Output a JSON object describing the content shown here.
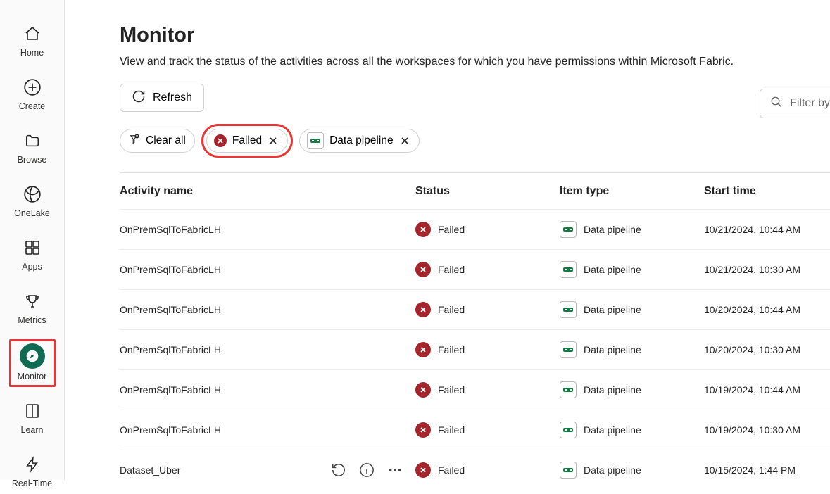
{
  "nav": {
    "items": [
      {
        "label": "Home"
      },
      {
        "label": "Create"
      },
      {
        "label": "Browse"
      },
      {
        "label": "OneLake"
      },
      {
        "label": "Apps"
      },
      {
        "label": "Metrics"
      },
      {
        "label": "Monitor"
      },
      {
        "label": "Learn"
      },
      {
        "label": "Real-Time"
      }
    ]
  },
  "header": {
    "title": "Monitor",
    "subtitle": "View and track the status of the activities across all the workspaces for which you have permissions within Microsoft Fabric."
  },
  "toolbar": {
    "refresh_label": "Refresh",
    "filter_placeholder": "Filter by"
  },
  "chips": {
    "clear_all": "Clear all",
    "failed": "Failed",
    "data_pipeline": "Data pipeline"
  },
  "table": {
    "columns": {
      "activity_name": "Activity name",
      "status": "Status",
      "item_type": "Item type",
      "start_time": "Start time"
    },
    "rows": [
      {
        "name": "OnPremSqlToFabricLH",
        "status": "Failed",
        "type": "Data pipeline",
        "start": "10/21/2024, 10:44 AM"
      },
      {
        "name": "OnPremSqlToFabricLH",
        "status": "Failed",
        "type": "Data pipeline",
        "start": "10/21/2024, 10:30 AM"
      },
      {
        "name": "OnPremSqlToFabricLH",
        "status": "Failed",
        "type": "Data pipeline",
        "start": "10/20/2024, 10:44 AM"
      },
      {
        "name": "OnPremSqlToFabricLH",
        "status": "Failed",
        "type": "Data pipeline",
        "start": "10/20/2024, 10:30 AM"
      },
      {
        "name": "OnPremSqlToFabricLH",
        "status": "Failed",
        "type": "Data pipeline",
        "start": "10/19/2024, 10:44 AM"
      },
      {
        "name": "OnPremSqlToFabricLH",
        "status": "Failed",
        "type": "Data pipeline",
        "start": "10/19/2024, 10:30 AM"
      },
      {
        "name": "Dataset_Uber",
        "status": "Failed",
        "type": "Data pipeline",
        "start": "10/15/2024, 1:44 PM",
        "show_actions": true
      }
    ]
  }
}
